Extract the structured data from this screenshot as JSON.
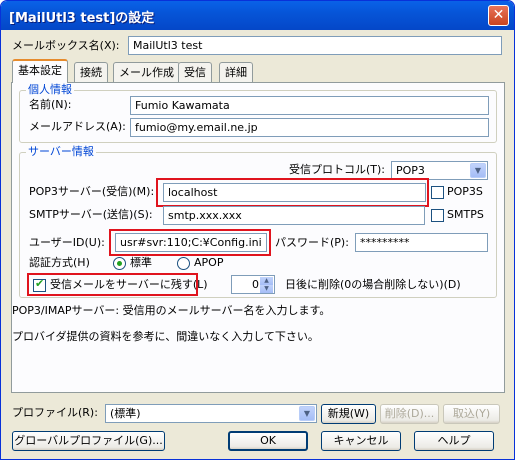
{
  "window": {
    "title": "[MailUtl3 test]の設定",
    "close_symbol": "✕"
  },
  "mailbox": {
    "label": "メールボックス名(X):",
    "value": "MailUtl3 test"
  },
  "tabs": [
    {
      "label": "基本設定"
    },
    {
      "label": "接続"
    },
    {
      "label": "メール作成"
    },
    {
      "label": "受信"
    },
    {
      "label": "詳細"
    }
  ],
  "personal": {
    "title": "個人情報",
    "name_label": "名前(N):",
    "name_value": "Fumio Kawamata",
    "email_label": "メールアドレス(A):",
    "email_value": "fumio@my.email.ne.jp"
  },
  "server": {
    "title": "サーバー情報",
    "protocol_label": "受信プロトコル(T):",
    "protocol_value": "POP3",
    "pop3_label": "POP3サーバー(受信)(M):",
    "pop3_value": "localhost",
    "pop3s_label": "POP3S",
    "smtp_label": "SMTPサーバー(送信)(S):",
    "smtp_value": "smtp.xxx.xxx",
    "smtps_label": "SMTPS",
    "userid_label": "ユーザーID(U):",
    "userid_value": "usr#svr:110;C:¥Config.ini",
    "password_label": "パスワード(P):",
    "password_value": "*********",
    "auth_label": "認証方式(H)",
    "auth_standard": "標準",
    "auth_apop": "APOP",
    "leave_mail_label": "受信メールをサーバーに残す(L)",
    "days_value": "0",
    "days_label": "日後に削除(0の場合削除しない)(D)"
  },
  "description": {
    "line1": "POP3/IMAPサーバー: 受信用のメールサーバー名を入力します。",
    "line2": "プロバイダ提供の資料を参考に、間違いなく入力して下さい。"
  },
  "profile": {
    "label": "プロファイル(R):",
    "value": "(標準)",
    "new_button": "新規(W)",
    "delete_button": "削除(D)...",
    "import_button": "取込(Y)"
  },
  "footer": {
    "global_profile_button": "グローバルプロファイル(G)...",
    "ok_button": "OK",
    "cancel_button": "キャンセル",
    "help_button": "ヘルプ"
  },
  "icons": {
    "dropdown": "▼",
    "spin_up": "▲",
    "spin_down": "▼"
  }
}
